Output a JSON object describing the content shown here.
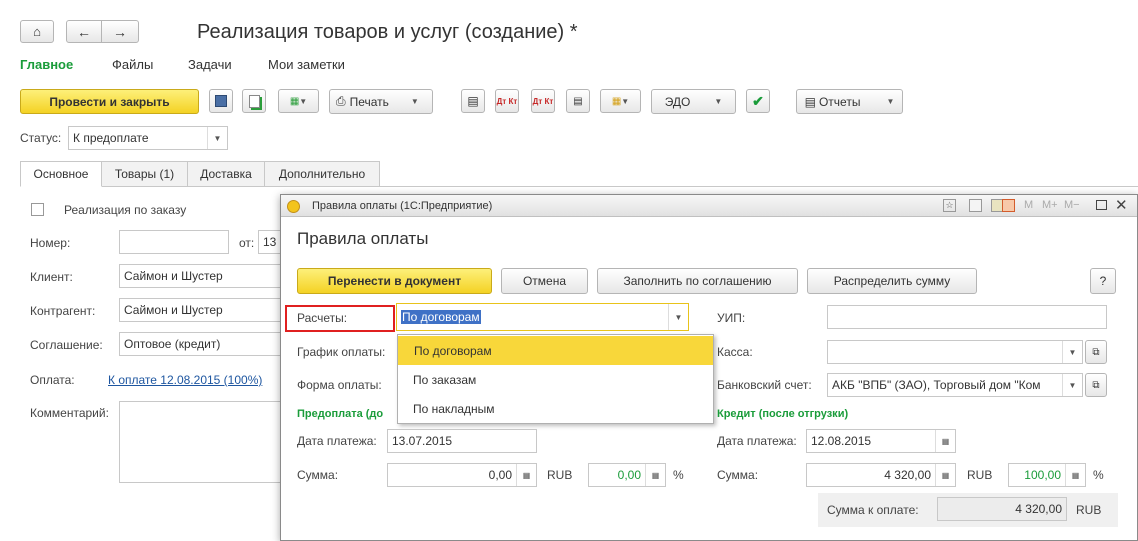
{
  "nav": {
    "home_icon": "home-icon",
    "back_icon": "arrow-left-icon",
    "fwd_icon": "arrow-right-icon"
  },
  "title": "Реализация товаров и услуг (создание) *",
  "sections": [
    "Главное",
    "Файлы",
    "Задачи",
    "Мои заметки"
  ],
  "toolbar": {
    "post_close": "Провести и закрыть",
    "print": "Печать",
    "edo": "ЭДО",
    "reports": "Отчеты",
    "dt_kt": "Дт Кт",
    "dt": "Дт",
    "kt": "Кт",
    "kt2": "Кт"
  },
  "status": {
    "label": "Статус:",
    "value": "К предоплате"
  },
  "tabs": [
    "Основное",
    "Товары (1)",
    "Доставка",
    "Дополнительно"
  ],
  "main": {
    "by_order_label": "Реализация по заказу",
    "number_label": "Номер:",
    "from_label": "от:",
    "date_value": "13",
    "client_label": "Клиент:",
    "client_value": "Саймон и Шустер",
    "counterparty_label": "Контрагент:",
    "counterparty_value": "Саймон и Шустер",
    "agreement_label": "Соглашение:",
    "agreement_value": "Оптовое (кредит)",
    "payment_label": "Оплата:",
    "payment_link": "К оплате 12.08.2015 (100%)",
    "comment_label": "Комментарий:"
  },
  "dialog": {
    "window_title": "Правила оплаты  (1С:Предприятие)",
    "title": "Правила оплаты",
    "btn_transfer": "Перенести в документ",
    "btn_cancel": "Отмена",
    "btn_fill": "Заполнить по соглашению",
    "btn_distribute": "Распределить сумму",
    "btn_help": "?",
    "wbtn_m": "M",
    "wbtn_mplus": "M+",
    "wbtn_mminus": "M−",
    "calc_label": "Расчеты:",
    "calc_value": "По договорам",
    "schedule_label": "График оплаты:",
    "form_label": "Форма оплаты:",
    "prepay_header": "Предоплата (до",
    "prepay_date_label": "Дата платежа:",
    "prepay_date": "13.07.2015",
    "prepay_sum_label": "Сумма:",
    "prepay_sum": "0,00",
    "prepay_cur": "RUB",
    "prepay_pct": "0,00",
    "pct_sign": "%",
    "uip_label": "УИП:",
    "cash_label": "Касса:",
    "bank_label": "Банковский счет:",
    "bank_value": "АКБ \"ВПБ\" (ЗАО), Торговый дом \"Ком",
    "credit_header": "Кредит (после отгрузки)",
    "credit_date_label": "Дата платежа:",
    "credit_date": "12.08.2015",
    "credit_sum_label": "Сумма:",
    "credit_sum": "4 320,00",
    "credit_cur": "RUB",
    "credit_pct": "100,00",
    "total_label": "Сумма к оплате:",
    "total_value": "4 320,00",
    "total_cur": "RUB",
    "dropdown_options": [
      "По договорам",
      "По заказам",
      "По накладным"
    ]
  }
}
